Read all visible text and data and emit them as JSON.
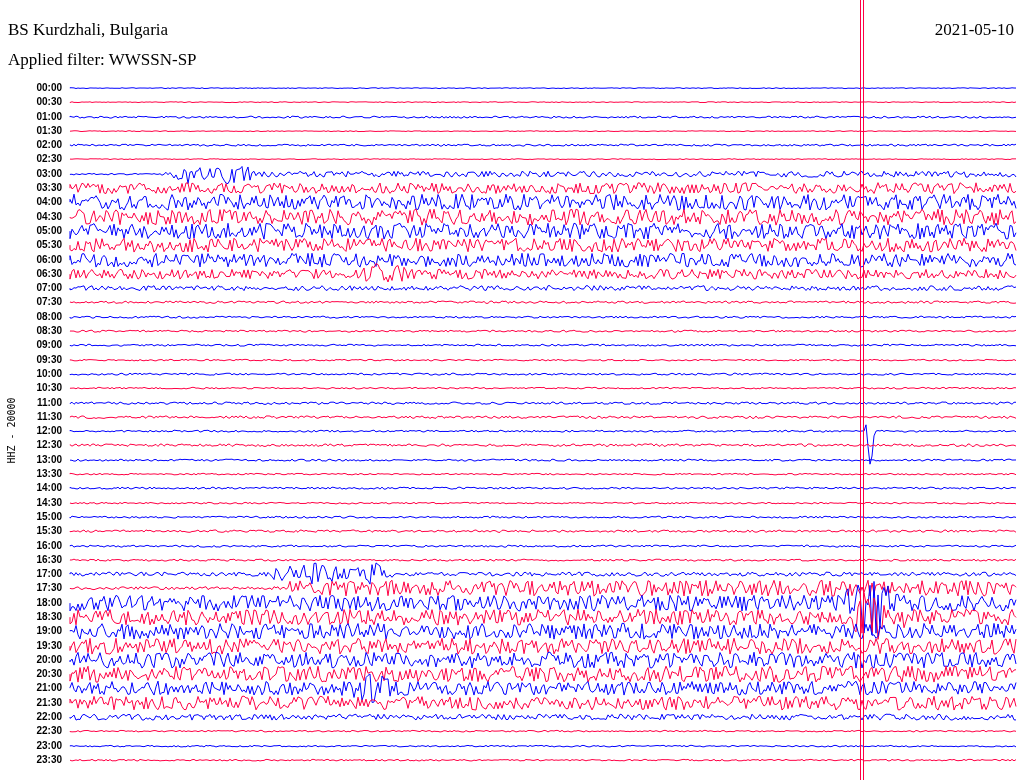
{
  "header": {
    "station": "BS Kurdzhali, Bulgaria",
    "date": "2021-05-10",
    "filter": "Applied filter: WWSSN-SP"
  },
  "axis_label": "HHZ - 20000",
  "rows": [
    {
      "time": "00:00",
      "color": "#0000ff"
    },
    {
      "time": "00:30",
      "color": "#ff0044"
    },
    {
      "time": "01:00",
      "color": "#0000ff"
    },
    {
      "time": "01:30",
      "color": "#ff0044"
    },
    {
      "time": "02:00",
      "color": "#0000ff"
    },
    {
      "time": "02:30",
      "color": "#ff0044"
    },
    {
      "time": "03:00",
      "color": "#0000ff"
    },
    {
      "time": "03:30",
      "color": "#ff0044"
    },
    {
      "time": "04:00",
      "color": "#0000ff"
    },
    {
      "time": "04:30",
      "color": "#ff0044"
    },
    {
      "time": "05:00",
      "color": "#0000ff"
    },
    {
      "time": "05:30",
      "color": "#ff0044"
    },
    {
      "time": "06:00",
      "color": "#0000ff"
    },
    {
      "time": "06:30",
      "color": "#ff0044"
    },
    {
      "time": "07:00",
      "color": "#0000ff"
    },
    {
      "time": "07:30",
      "color": "#ff0044"
    },
    {
      "time": "08:00",
      "color": "#0000ff"
    },
    {
      "time": "08:30",
      "color": "#ff0044"
    },
    {
      "time": "09:00",
      "color": "#0000ff"
    },
    {
      "time": "09:30",
      "color": "#ff0044"
    },
    {
      "time": "10:00",
      "color": "#0000ff"
    },
    {
      "time": "10:30",
      "color": "#ff0044"
    },
    {
      "time": "11:00",
      "color": "#0000ff"
    },
    {
      "time": "11:30",
      "color": "#ff0044"
    },
    {
      "time": "12:00",
      "color": "#0000ff"
    },
    {
      "time": "12:30",
      "color": "#ff0044"
    },
    {
      "time": "13:00",
      "color": "#0000ff"
    },
    {
      "time": "13:30",
      "color": "#ff0044"
    },
    {
      "time": "14:00",
      "color": "#0000ff"
    },
    {
      "time": "14:30",
      "color": "#ff0044"
    },
    {
      "time": "15:00",
      "color": "#0000ff"
    },
    {
      "time": "15:30",
      "color": "#ff0044"
    },
    {
      "time": "16:00",
      "color": "#0000ff"
    },
    {
      "time": "16:30",
      "color": "#ff0044"
    },
    {
      "time": "17:00",
      "color": "#0000ff"
    },
    {
      "time": "17:30",
      "color": "#ff0044"
    },
    {
      "time": "18:00",
      "color": "#0000ff"
    },
    {
      "time": "18:30",
      "color": "#ff0044"
    },
    {
      "time": "19:00",
      "color": "#0000ff"
    },
    {
      "time": "19:30",
      "color": "#ff0044"
    },
    {
      "time": "20:00",
      "color": "#0000ff"
    },
    {
      "time": "20:30",
      "color": "#ff0044"
    },
    {
      "time": "21:00",
      "color": "#0000ff"
    },
    {
      "time": "21:30",
      "color": "#ff0044"
    },
    {
      "time": "22:00",
      "color": "#0000ff"
    },
    {
      "time": "22:30",
      "color": "#ff0044"
    },
    {
      "time": "23:00",
      "color": "#0000ff"
    },
    {
      "time": "23:30",
      "color": "#ff0044"
    }
  ]
}
